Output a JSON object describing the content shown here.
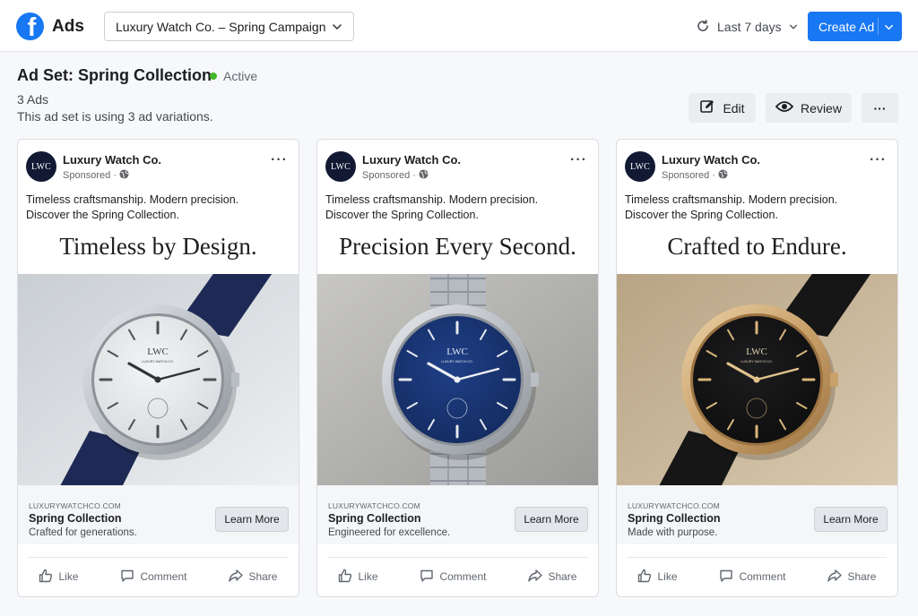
{
  "app": {
    "logo_letter": "f",
    "title": "Ads"
  },
  "campaign_selector": {
    "value": "Luxury Watch Co. – Spring Campaign"
  },
  "date_range": {
    "label": "Last 7 days"
  },
  "create_ad": {
    "label": "Create Ad"
  },
  "adset": {
    "title": "Ad Set: Spring Collection",
    "status": "Active",
    "count": "3 Ads",
    "description": "This ad set is using 3 ad variations."
  },
  "toolbar": {
    "edit_label": "Edit",
    "review_label": "Review",
    "more_label": "···"
  },
  "colors": {
    "brand": "#1877f2",
    "active": "#42b72a"
  },
  "ads": [
    {
      "page_name": "Luxury Watch Co.",
      "avatar_text": "LWC",
      "sponsored": "Sponsored ·",
      "copy_line1": "Timeless craftsmanship. Modern precision.",
      "copy_line2": "Discover the Spring Collection.",
      "headline": "Timeless by Design.",
      "domain": "LUXURYWATCHCO.COM",
      "link_title": "Spring Collection",
      "link_desc": "Crafted for generations.",
      "cta": "Learn More",
      "watch": {
        "dial": "white",
        "case": "steel",
        "strap": "navy leather"
      }
    },
    {
      "page_name": "Luxury Watch Co.",
      "avatar_text": "LWC",
      "sponsored": "Sponsored ·",
      "copy_line1": "Timeless craftsmanship. Modern precision.",
      "copy_line2": "Discover the Spring Collection.",
      "headline": "Precision Every Second.",
      "domain": "LUXURYWATCHCO.COM",
      "link_title": "Spring Collection",
      "link_desc": "Engineered for excellence.",
      "cta": "Learn More",
      "watch": {
        "dial": "blue",
        "case": "steel",
        "strap": "steel bracelet"
      }
    },
    {
      "page_name": "Luxury Watch Co.",
      "avatar_text": "LWC",
      "sponsored": "Sponsored ·",
      "copy_line1": "Timeless craftsmanship. Modern precision.",
      "copy_line2": "Discover the Spring Collection.",
      "headline": "Crafted to Endure.",
      "domain": "LUXURYWATCHCO.COM",
      "link_title": "Spring Collection",
      "link_desc": "Made with purpose.",
      "cta": "Learn More",
      "watch": {
        "dial": "black",
        "case": "gold",
        "strap": "black leather"
      }
    }
  ],
  "post_actions": {
    "like": "Like",
    "comment": "Comment",
    "share": "Share"
  },
  "watch_brand": {
    "logo": "LWC",
    "subtext": "LUXURY WATCH CO."
  }
}
